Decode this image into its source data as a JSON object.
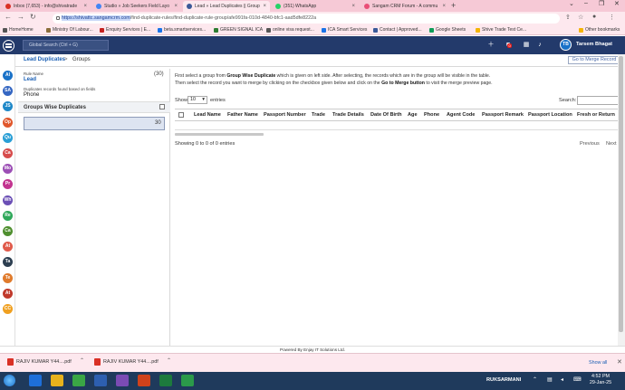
{
  "browser": {
    "tabs": [
      {
        "label": "Inbox (7,653) - info@shivatrade",
        "color": "#d93025",
        "active": false
      },
      {
        "label": "Studio » Job Seekers Field Layo",
        "color": "#4285f4",
        "active": false
      },
      {
        "label": "Lead » Lead Duplicates || Group",
        "color": "#3b5998",
        "active": true
      },
      {
        "label": "(351) WhatsApp",
        "color": "#25d366",
        "active": false
      },
      {
        "label": "Sangam CRM Forum - A commu",
        "color": "#e94e77",
        "active": false
      }
    ],
    "new_tab": "+",
    "url_host": "https://shivattc.sangamcrm.com",
    "url_path": "/find-duplicate-rules/find-duplicate-rule-group/afe991fa-010d-4840-bfc1-aad5dfe8222a",
    "bookmarks": [
      {
        "label": "HomeHome",
        "color": "#555555"
      },
      {
        "label": "Ministry Of Labour...",
        "color": "#8a6d3b"
      },
      {
        "label": "Enquiry Services | E...",
        "color": "#c5221f"
      },
      {
        "label": "beta.smartservices...",
        "color": "#1a73e8"
      },
      {
        "label": "GREEN SIGNAL ICA",
        "color": "#2e7d32"
      },
      {
        "label": "online visa request...",
        "color": "#555555"
      },
      {
        "label": "ICA Smart Services",
        "color": "#1a73e8"
      },
      {
        "label": "Contact | Approved...",
        "color": "#3b5998"
      },
      {
        "label": "Google Sheets",
        "color": "#0f9d58"
      },
      {
        "label": "Shive Trade Test Ce...",
        "color": "#f4b400"
      }
    ],
    "other_bookmarks": "Other bookmarks"
  },
  "header": {
    "search_placeholder": "Global Search (Ctrl + G)",
    "notif_count": "0",
    "user_initials": "TB",
    "user_name": "Tarsem Bhagat"
  },
  "rail": [
    {
      "abbr": "Al",
      "color": "#1a72c8"
    },
    {
      "abbr": "SA",
      "color": "#3466c2"
    },
    {
      "abbr": "JS",
      "color": "#1e88c8"
    },
    {
      "abbr": "Op",
      "color": "#e0572c"
    },
    {
      "abbr": "Qu",
      "color": "#2a9fd6"
    },
    {
      "abbr": "Ca",
      "color": "#d74c4c"
    },
    {
      "abbr": "Mo",
      "color": "#9c4fb5"
    },
    {
      "abbr": "Pr",
      "color": "#c2338f"
    },
    {
      "abbr": "Wh",
      "color": "#6b4fb5"
    },
    {
      "abbr": "Re",
      "color": "#2fa85a"
    },
    {
      "abbr": "Ca",
      "color": "#4f8f2f"
    },
    {
      "abbr": "At",
      "color": "#e05a4a"
    },
    {
      "abbr": "Ta",
      "color": "#2c3e50"
    },
    {
      "abbr": "Te",
      "color": "#e07b2c"
    },
    {
      "abbr": "At",
      "color": "#c0392b"
    },
    {
      "abbr": "CC",
      "color": "#f0a020"
    }
  ],
  "breadcrumb": {
    "lead": "Lead Duplicates",
    "sep": ">",
    "current": "Groups"
  },
  "merge_button": "Go to Merge Record",
  "left": {
    "rule_label": "Rule Name",
    "rule_value": "Lead",
    "rule_count": "(30)",
    "dup_label": "Duplicates records found based on fields",
    "dup_value": "Phone",
    "groups_title": "Groups Wise Duplicates",
    "group_count": "30"
  },
  "main": {
    "info_1a": "First select a group from ",
    "info_1b": "Group Wise Duplicate",
    "info_1c": " which is given on left side. After selecting, the records which are in the group will be visible in the table.",
    "info_2a": "Then select the record you want to merge by clicking on the checkbox given below and click on the ",
    "info_2b": "Go to Merge button",
    "info_2c": " to visit the merge preview page.",
    "show_label": "Show",
    "show_value": "10",
    "entries_label": "entries",
    "search_label": "Search:",
    "columns": [
      "Lead Name",
      "Father Name",
      "Passport Number",
      "Trade",
      "Trade Details",
      "Date Of Birth",
      "Age",
      "Phone",
      "Agent Code",
      "Passport Remark",
      "Passport Location",
      "Fresh or Return"
    ],
    "showing": "Showing 0 to 0 of 0 entries",
    "previous": "Previous",
    "next": "Next"
  },
  "footer": "Powered By Enjay IT Solutions Ltd.",
  "downloads": {
    "items": [
      "RAJIV KUMAR Y44....pdf",
      "RAJIV KUMAR Y44....pdf"
    ],
    "show_all": "Show all"
  },
  "taskbar": {
    "user": "RUKSARMANI",
    "time": "4:52 PM",
    "date": "29-Jan-25"
  }
}
